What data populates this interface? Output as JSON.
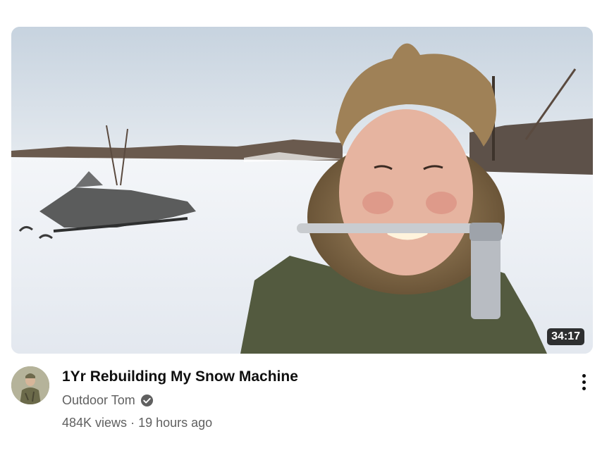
{
  "video": {
    "title": "1Yr Rebuilding My Snow Machine",
    "duration": "34:17",
    "channel": "Outdoor Tom",
    "views": "484K views",
    "separator": "·",
    "age": "19 hours ago",
    "verified_icon": "verified-check-icon",
    "menu_icon": "more-vert-icon"
  }
}
